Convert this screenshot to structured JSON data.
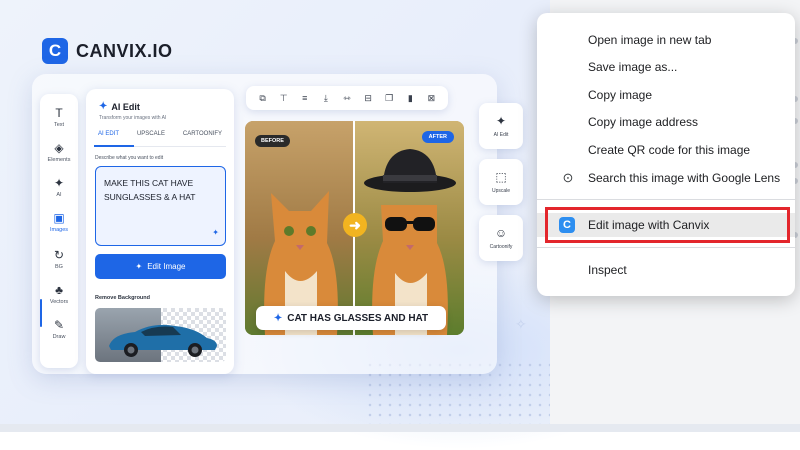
{
  "brand": {
    "logo_letter": "C",
    "name": "CANVIX.IO"
  },
  "tools": [
    {
      "label": "Text",
      "icon": "text-icon",
      "glyph": "T"
    },
    {
      "label": "Elements",
      "icon": "layers-icon",
      "glyph": "◈"
    },
    {
      "label": "AI",
      "icon": "magic-wand-icon",
      "glyph": "✦"
    },
    {
      "label": "Images",
      "icon": "image-icon",
      "glyph": "▣"
    },
    {
      "label": "BG",
      "icon": "refresh-icon",
      "glyph": "↻"
    },
    {
      "label": "Vectors",
      "icon": "shapes-icon",
      "glyph": "♣"
    },
    {
      "label": "Draw",
      "icon": "pencil-icon",
      "glyph": "✎"
    }
  ],
  "panel": {
    "title": "AI Edit",
    "subtitle": "Transform your images with AI",
    "tabs": [
      "AI EDIT",
      "UPSCALE",
      "CARTOONIFY"
    ],
    "prompt_label": "Describe what you want to edit",
    "prompt_text": "MAKE THIS CAT HAVE SUNGLASSES & A HAT",
    "edit_button": "Edit Image",
    "remove_bg_label": "Remove Background"
  },
  "toolbar_icons": [
    "copy-icon",
    "text-align-icon",
    "align-icon",
    "download-icon",
    "flip-icon",
    "crop-icon",
    "duplicate-icon",
    "delete-icon",
    "lock-icon"
  ],
  "compare": {
    "before": "BEFORE",
    "after": "AFTER",
    "caption": "CAT HAS GLASSES AND HAT"
  },
  "side_tools": [
    {
      "label": "AI Edit",
      "icon": "magic-wand-icon",
      "glyph": "✦"
    },
    {
      "label": "Upscale",
      "icon": "upscale-icon",
      "glyph": "⬚"
    },
    {
      "label": "Cartoonify",
      "icon": "smiley-icon",
      "glyph": "☺"
    }
  ],
  "menu": {
    "items": [
      "Open image in new tab",
      "Save image as...",
      "Copy image",
      "Copy image address",
      "Create QR code for this image",
      "Search this image with Google Lens"
    ],
    "canvix_item": "Edit image with Canvix",
    "inspect": "Inspect",
    "canvix_letter": "C"
  },
  "colors": {
    "accent": "#1e66e6",
    "highlight_border": "#e3262c"
  }
}
